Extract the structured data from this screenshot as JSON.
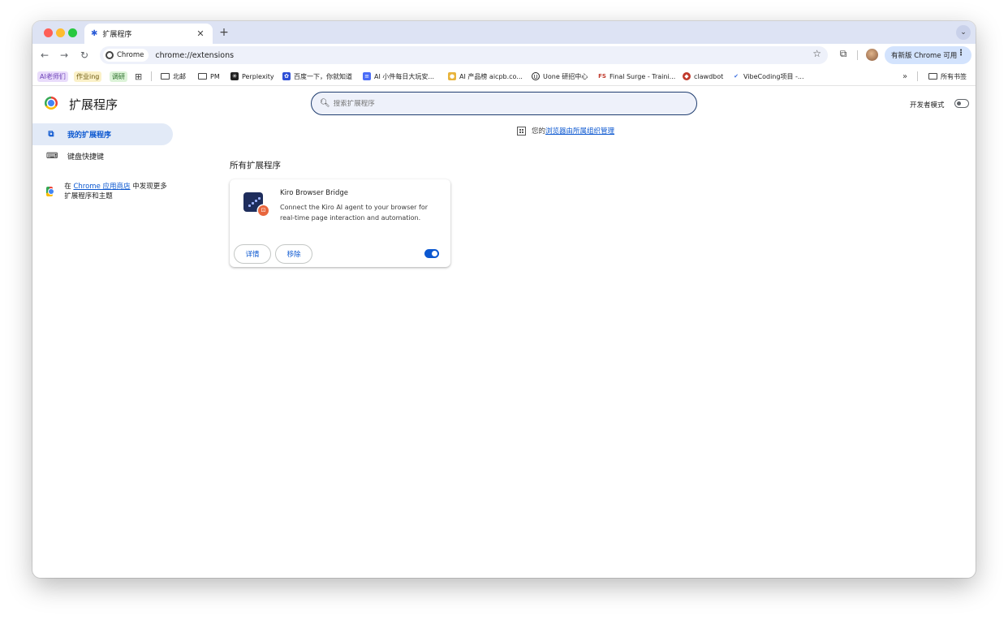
{
  "tab": {
    "title": "扩展程序",
    "close": "✕",
    "new_tab": "+"
  },
  "toolbar": {
    "back": "←",
    "forward": "→",
    "reload": "↻",
    "chip_label": "Chrome",
    "url": "chrome://extensions",
    "update_label": "有新版 Chrome 可用",
    "menu_dots": "⋮"
  },
  "bookmarks": {
    "items": [
      {
        "label": "AI老师们",
        "style": "purple"
      },
      {
        "label": "作业ing",
        "style": "yellow"
      },
      {
        "label": "调研",
        "style": "green"
      },
      {
        "label": "北邮"
      },
      {
        "label": "PM"
      },
      {
        "label": "Perplexity"
      },
      {
        "label": "百度一下，你就知道"
      },
      {
        "label": "AI 小件每日大玩安..."
      },
      {
        "label": "AI 产品榜 aicpb.co..."
      },
      {
        "label": "Uone 研招中心"
      },
      {
        "label": "Final Surge - Traini..."
      },
      {
        "label": "clawdbot"
      },
      {
        "label": "VibeCoding项目 -..."
      }
    ],
    "overflow": "»",
    "all_bookmarks": "所有书签"
  },
  "header": {
    "title": "扩展程序",
    "search_placeholder": "搜索扩展程序",
    "dev_mode_label": "开发者模式",
    "dev_mode_on": false
  },
  "sidebar": {
    "items": [
      {
        "label": "我的扩展程序",
        "active": true
      },
      {
        "label": "键盘快捷键",
        "active": false
      }
    ],
    "store_prefix": "在 ",
    "store_link": "Chrome 应用商店",
    "store_suffix": " 中发现更多扩展程序和主题"
  },
  "main": {
    "managed_prefix": "您的",
    "managed_link": "浏览器由所属组织管理",
    "section_title": "所有扩展程序",
    "extensions": [
      {
        "name": "Kiro Browser Bridge",
        "description": "Connect the Kiro AI agent to your browser for real-time page interaction and automation.",
        "details_label": "详情",
        "remove_label": "移除",
        "enabled": true
      }
    ]
  },
  "colors": {
    "accent": "#0b57d0",
    "tabstrip": "#dde3f4",
    "active_nav": "#e2eaf7"
  }
}
